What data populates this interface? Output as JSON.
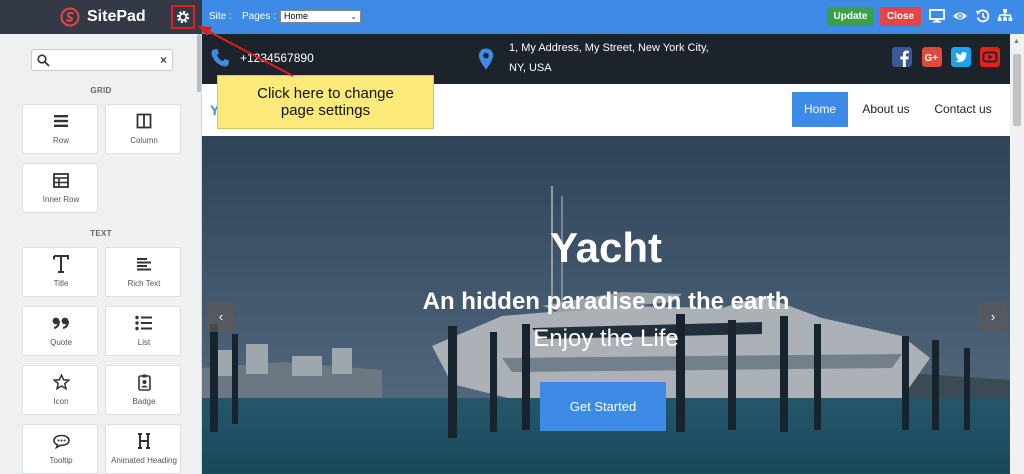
{
  "sidebar": {
    "brand_name": "SitePad",
    "search": {
      "value": "",
      "placeholder": ""
    },
    "sections": [
      {
        "heading": "GRID",
        "tiles": [
          {
            "label": "Row",
            "icon": "row-icon"
          },
          {
            "label": "Column",
            "icon": "column-icon"
          },
          {
            "label": "Inner Row",
            "icon": "inner-row-icon"
          }
        ]
      },
      {
        "heading": "TEXT",
        "tiles": [
          {
            "label": "Title",
            "icon": "title-icon"
          },
          {
            "label": "Rich Text",
            "icon": "rich-text-icon"
          },
          {
            "label": "Quote",
            "icon": "quote-icon"
          },
          {
            "label": "List",
            "icon": "list-icon"
          },
          {
            "label": "Icon",
            "icon": "star-icon"
          },
          {
            "label": "Badge",
            "icon": "badge-icon"
          },
          {
            "label": "Tooltip",
            "icon": "tooltip-icon"
          },
          {
            "label": "Animated Heading",
            "icon": "animated-heading-icon"
          }
        ]
      }
    ],
    "clear_glyph": "×",
    "collapse_glyph": "‹"
  },
  "topbar": {
    "site_label": "Site :",
    "pages_label": "Pages :",
    "pages_selected": "Home",
    "update_label": "Update",
    "close_label": "Close"
  },
  "preview": {
    "phone": "+1234567890",
    "address_line1": "1, My Address, My Street, New York City,",
    "address_line2": "NY, USA",
    "nav": [
      "Home",
      "About us",
      "Contact us"
    ],
    "hero_title": "Yacht",
    "hero_subtitle": "An hidden paradise on the earth",
    "hero_tagline": "Enjoy the Life",
    "cta_label": "Get Started",
    "prev_glyph": "‹",
    "next_glyph": "›"
  },
  "annotation": {
    "line1": "Click here to change",
    "line2": "page settings"
  },
  "colors": {
    "accent": "#3d8be6",
    "update": "#3aa14a",
    "close": "#e4454b",
    "facebook": "#3b5998",
    "google": "#dd4b39",
    "twitter": "#1da1f2",
    "youtube": "#e62117"
  }
}
